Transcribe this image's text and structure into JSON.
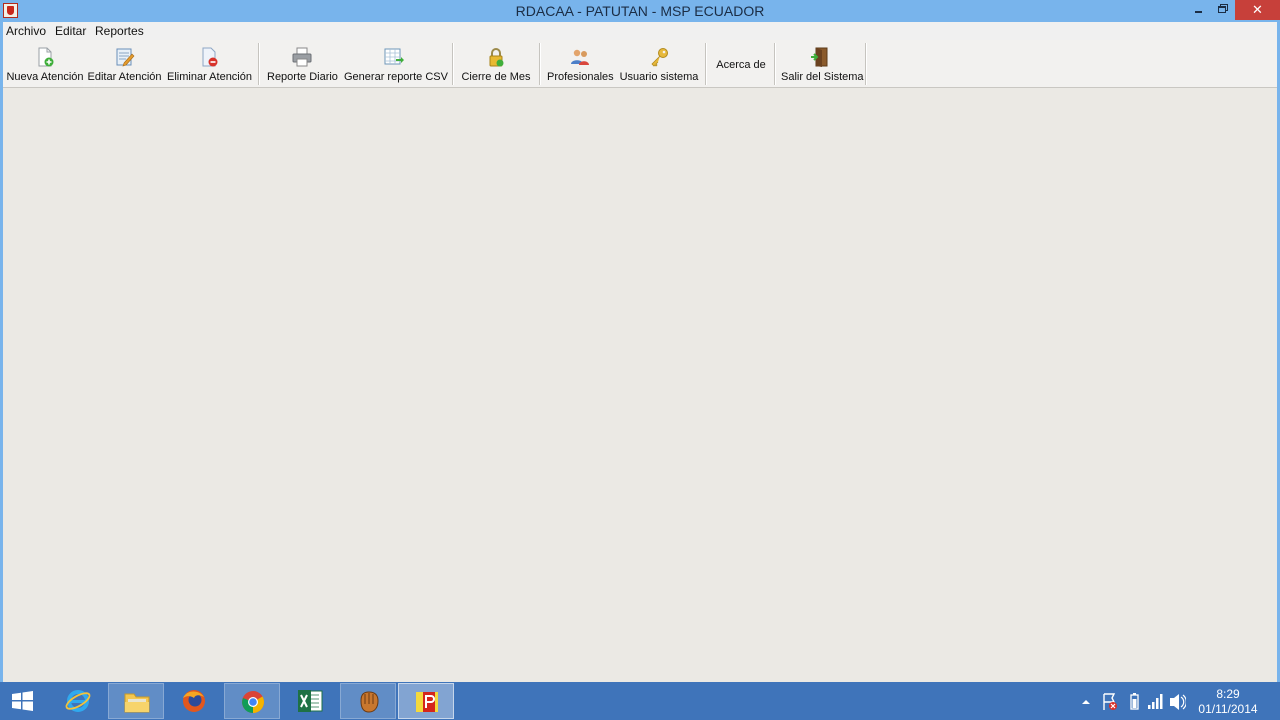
{
  "window": {
    "title": "RDACAA - PATUTAN - MSP ECUADOR",
    "controls": {
      "minimize": "minimize",
      "maximize": "restore",
      "close": "✕"
    }
  },
  "menu": {
    "items": [
      {
        "label": "Archivo"
      },
      {
        "label": "Editar"
      },
      {
        "label": "Reportes"
      }
    ]
  },
  "toolbar": {
    "buttons": [
      {
        "label": "Nueva Atención",
        "icon": "new-document-icon"
      },
      {
        "label": "Editar Atención",
        "icon": "edit-document-icon"
      },
      {
        "label": "Eliminar Atención",
        "icon": "delete-document-icon"
      },
      {
        "label": "Reporte Diario",
        "icon": "printer-icon"
      },
      {
        "label": "Generar reporte CSV",
        "icon": "spreadsheet-export-icon"
      },
      {
        "label": "Cierre de Mes",
        "icon": "lock-icon"
      },
      {
        "label": "Profesionales",
        "icon": "users-icon"
      },
      {
        "label": "Usuario sistema",
        "icon": "key-icon"
      },
      {
        "label": "Acerca de",
        "icon": ""
      },
      {
        "label": "Salir del Sistema",
        "icon": "exit-door-icon"
      }
    ]
  },
  "taskbar": {
    "apps": [
      {
        "name": "Internet Explorer",
        "icon": "ie-icon"
      },
      {
        "name": "File Explorer",
        "icon": "folder-icon"
      },
      {
        "name": "Firefox",
        "icon": "firefox-icon"
      },
      {
        "name": "Chrome",
        "icon": "chrome-icon"
      },
      {
        "name": "Excel",
        "icon": "excel-icon"
      },
      {
        "name": "Game app",
        "icon": "glove-icon"
      },
      {
        "name": "RDACAA",
        "icon": "rdacaa-icon"
      }
    ],
    "clock": {
      "time": "8:29",
      "date": "01/11/2014"
    }
  },
  "colors": {
    "titlebar": "#78b4ec",
    "close_button": "#c7403a",
    "taskbar": "#3f74ba",
    "client_background": "#ebe9e4"
  }
}
